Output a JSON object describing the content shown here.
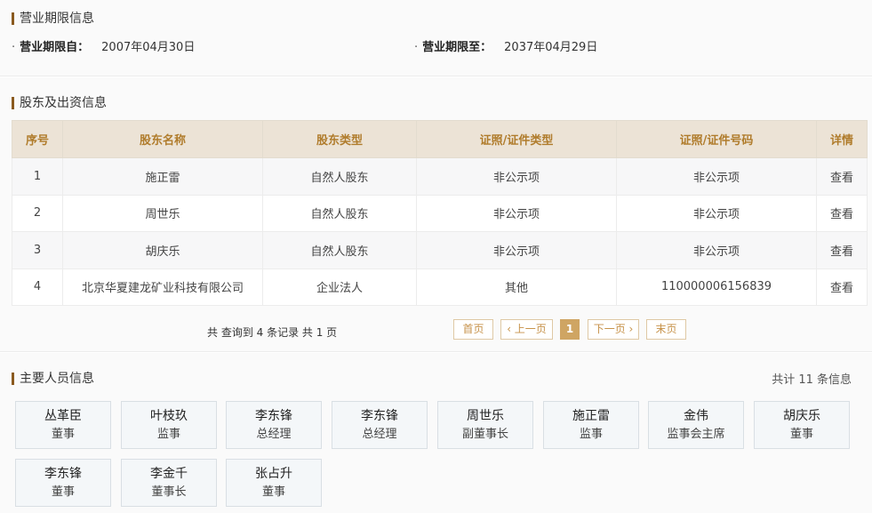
{
  "period": {
    "title": "营业期限信息",
    "from_label": "营业期限自：",
    "from_value": "2007年04月30日",
    "to_label": "营业期限至：",
    "to_value": "2037年04月29日"
  },
  "shareholders": {
    "title": "股东及出资信息",
    "headers": [
      "序号",
      "股东名称",
      "股东类型",
      "证照/证件类型",
      "证照/证件号码",
      "详情"
    ],
    "rows": [
      [
        "1",
        "施正雷",
        "自然人股东",
        "非公示项",
        "非公示项",
        "查看"
      ],
      [
        "2",
        "周世乐",
        "自然人股东",
        "非公示项",
        "非公示项",
        "查看"
      ],
      [
        "3",
        "胡庆乐",
        "自然人股东",
        "非公示项",
        "非公示项",
        "查看"
      ],
      [
        "4",
        "北京华夏建龙矿业科技有限公司",
        "企业法人",
        "其他",
        "110000006156839",
        "查看"
      ]
    ],
    "pager_summary": "共 查询到 4 条记录 共 1 页",
    "pager_first": "首页",
    "pager_prev": "‹ 上一页",
    "pager_current": "1",
    "pager_next": "下一页 ›",
    "pager_last": "末页"
  },
  "personnel": {
    "title": "主要人员信息",
    "total": "共计 11 条信息",
    "people": [
      {
        "name": "丛革臣",
        "role": "董事"
      },
      {
        "name": "叶枝玖",
        "role": "监事"
      },
      {
        "name": "李东锋",
        "role": "总经理"
      },
      {
        "name": "李东锋",
        "role": "总经理"
      },
      {
        "name": "周世乐",
        "role": "副董事长"
      },
      {
        "name": "施正雷",
        "role": "监事"
      },
      {
        "name": "金伟",
        "role": "监事会主席"
      },
      {
        "name": "胡庆乐",
        "role": "董事"
      },
      {
        "name": "李东锋",
        "role": "董事"
      },
      {
        "name": "李金千",
        "role": "董事长"
      },
      {
        "name": "张占升",
        "role": "董事"
      }
    ]
  }
}
